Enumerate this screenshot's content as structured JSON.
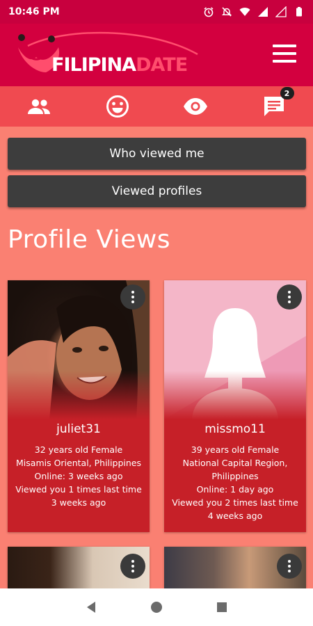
{
  "status_bar": {
    "time": "10:46 PM"
  },
  "app": {
    "logo_text_white": "FILIPINA",
    "logo_text_pink": "DATE",
    "brand_color": "#d3003f",
    "accent_color": "#fa8072"
  },
  "tabs": [
    {
      "icon": "people-icon"
    },
    {
      "icon": "smiley-icon"
    },
    {
      "icon": "eye-icon"
    },
    {
      "icon": "chat-icon",
      "badge": "2"
    }
  ],
  "buttons": {
    "who_viewed_me": "Who viewed me",
    "viewed_profiles": "Viewed profiles"
  },
  "section_title": "Profile Views",
  "profiles": [
    {
      "username": "juliet31",
      "line1": "32 years old Female",
      "line2": "Misamis Oriental, Philippines",
      "line3": "Online: 3 weeks ago",
      "line4": "Viewed you 1 times last time",
      "line5": "3 weeks ago"
    },
    {
      "username": "missmo11",
      "line1": "39 years old Female",
      "line2": "National Capital Region,",
      "line2b": "Philippines",
      "line3": "Online: 1 day ago",
      "line4": "Viewed you 2 times last time",
      "line5": "4 weeks ago"
    }
  ]
}
